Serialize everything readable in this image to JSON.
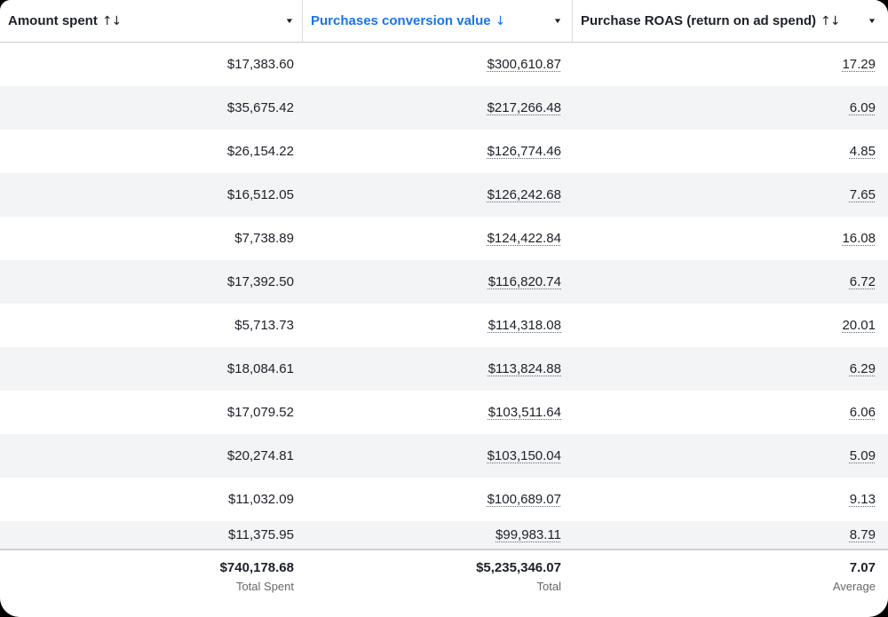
{
  "table": {
    "columns": [
      {
        "label": "Amount spent",
        "sort_icon": "↑↓",
        "active": false
      },
      {
        "label": "Purchases conversion value",
        "sort_icon": "↓",
        "active": true
      },
      {
        "label": "Purchase ROAS (return on ad spend)",
        "sort_icon": "↑↓",
        "active": false
      }
    ],
    "rows": [
      {
        "amount_spent": "$17,383.60",
        "purchases_conversion_value": "$300,610.87",
        "purchase_roas": "17.29"
      },
      {
        "amount_spent": "$35,675.42",
        "purchases_conversion_value": "$217,266.48",
        "purchase_roas": "6.09"
      },
      {
        "amount_spent": "$26,154.22",
        "purchases_conversion_value": "$126,774.46",
        "purchase_roas": "4.85"
      },
      {
        "amount_spent": "$16,512.05",
        "purchases_conversion_value": "$126,242.68",
        "purchase_roas": "7.65"
      },
      {
        "amount_spent": "$7,738.89",
        "purchases_conversion_value": "$124,422.84",
        "purchase_roas": "16.08"
      },
      {
        "amount_spent": "$17,392.50",
        "purchases_conversion_value": "$116,820.74",
        "purchase_roas": "6.72"
      },
      {
        "amount_spent": "$5,713.73",
        "purchases_conversion_value": "$114,318.08",
        "purchase_roas": "20.01"
      },
      {
        "amount_spent": "$18,084.61",
        "purchases_conversion_value": "$113,824.88",
        "purchase_roas": "6.29"
      },
      {
        "amount_spent": "$17,079.52",
        "purchases_conversion_value": "$103,511.64",
        "purchase_roas": "6.06"
      },
      {
        "amount_spent": "$20,274.81",
        "purchases_conversion_value": "$103,150.04",
        "purchase_roas": "5.09"
      },
      {
        "amount_spent": "$11,032.09",
        "purchases_conversion_value": "$100,689.07",
        "purchase_roas": "9.13"
      },
      {
        "amount_spent": "$11,375.95",
        "purchases_conversion_value": "$99,983.11",
        "purchase_roas": "8.79"
      }
    ],
    "footer": {
      "amount_spent": {
        "value": "$740,178.68",
        "label": "Total Spent"
      },
      "purchases_conversion_value": {
        "value": "$5,235,346.07",
        "label": "Total"
      },
      "purchase_roas": {
        "value": "7.07",
        "label": "Average"
      }
    },
    "colors": {
      "active_sort_blue": "#1b74e4",
      "row_stripe": "#f3f4f6",
      "header_border": "#c9cdd2",
      "text_primary": "#1c2028",
      "label_gray": "#65676b"
    }
  }
}
